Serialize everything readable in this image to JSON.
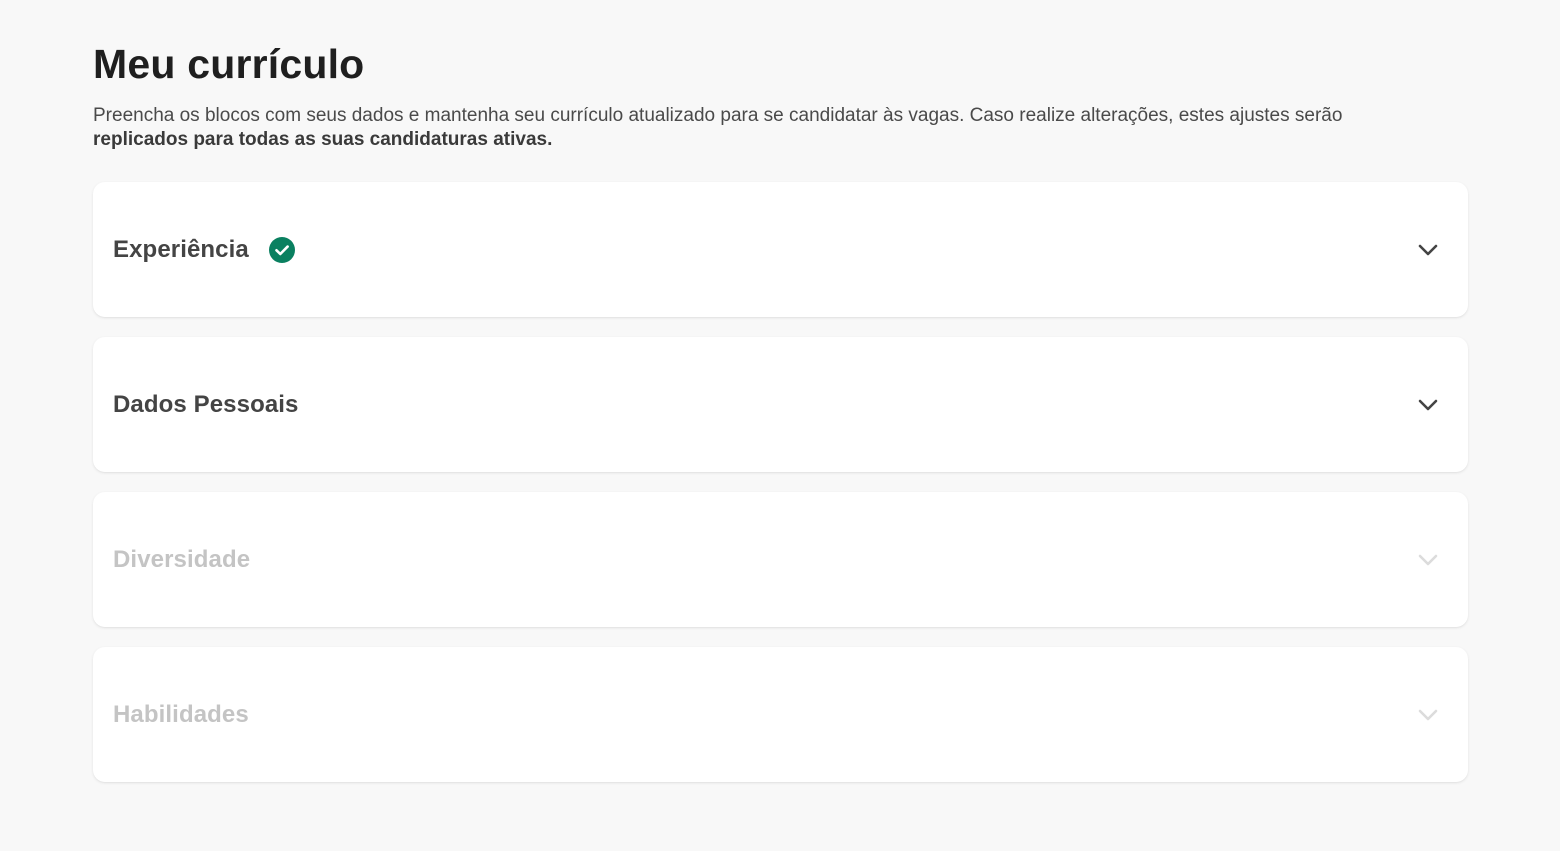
{
  "header": {
    "title": "Meu currículo",
    "description_start": "Preencha os blocos com seus dados e mantenha seu currículo atualizado para se candidatar às vagas. Caso realize alterações, estes ajustes serão ",
    "description_bold": "replicados para todas as suas candidaturas ativas."
  },
  "sections": [
    {
      "title": "Experiência",
      "status_icon": "check-circle-icon",
      "state": "completed",
      "toggle_icon": "chevron-down-icon"
    },
    {
      "title": "Dados Pessoais",
      "state": "active",
      "toggle_icon": "chevron-down-icon"
    },
    {
      "title": "Diversidade",
      "state": "disabled",
      "toggle_icon": "chevron-down-icon"
    },
    {
      "title": "Habilidades",
      "state": "disabled",
      "toggle_icon": "chevron-down-icon"
    }
  ],
  "colors": {
    "background": "#f8f8f8",
    "card": "#ffffff",
    "success": "#0a8060",
    "text_primary": "#1f1f1f",
    "text_disabled": "#c4c4c4"
  }
}
